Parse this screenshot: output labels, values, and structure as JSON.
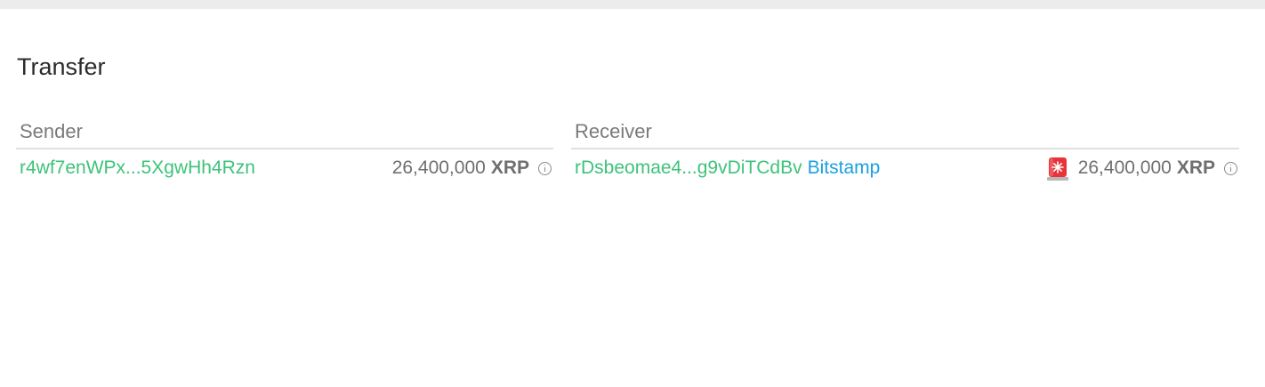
{
  "title": "Transfer",
  "sender": {
    "header": "Sender",
    "address": "r4wf7enWPx...5XgwHh4Rzn",
    "amount": "26,400,000",
    "currency": "XRP",
    "info_icon": "info-icon"
  },
  "receiver": {
    "header": "Receiver",
    "address": "rDsbeomae4...g9vDiTCdBv",
    "tag": "Bitstamp",
    "alert_icon": "rotating-light-icon",
    "amount": "26,400,000",
    "currency": "XRP",
    "info_icon": "info-icon"
  },
  "colors": {
    "address": "#3ec27a",
    "tag": "#1aa0e0",
    "alert": "#e8333a"
  }
}
